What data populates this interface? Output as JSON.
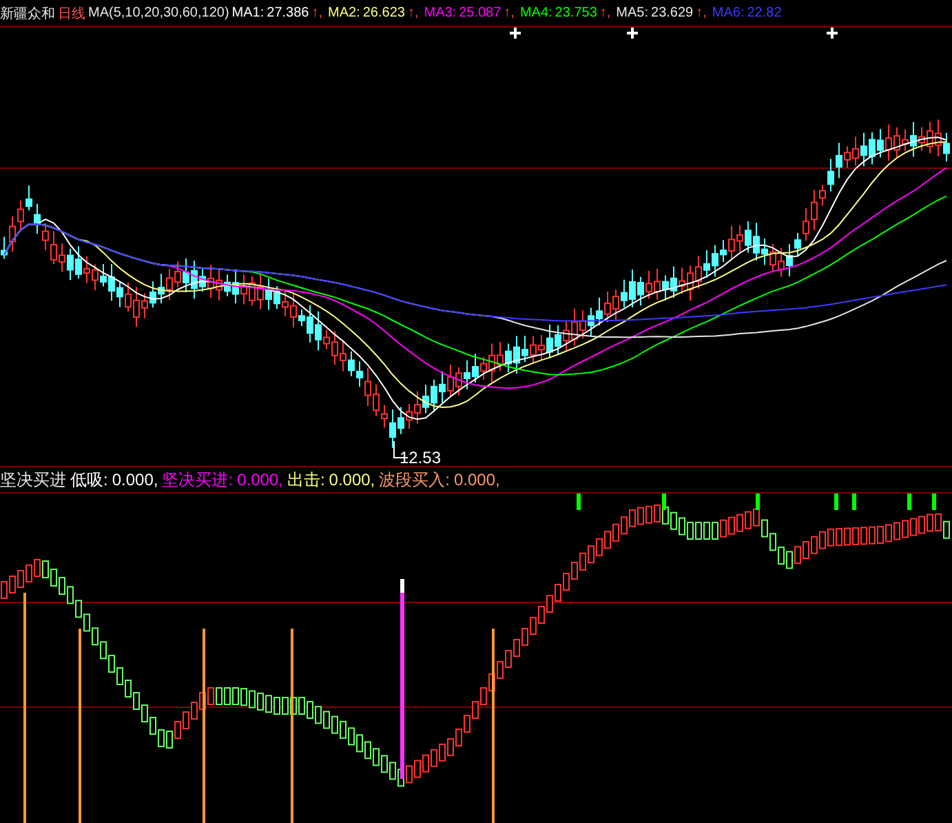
{
  "main_panel": {
    "stock_name": "新疆众和",
    "period": "日线",
    "ma_params": "MA(5,10,20,30,60,120)",
    "ma_items": [
      {
        "label": "MA1:",
        "value": "27.386",
        "arrow": "↑,",
        "color": "#ffffff"
      },
      {
        "label": "MA2:",
        "value": "26.623",
        "arrow": "↑,",
        "color": "#ffff80"
      },
      {
        "label": "MA3:",
        "value": "25.087",
        "arrow": "↑,",
        "color": "#ff00ff"
      },
      {
        "label": "MA4:",
        "value": "23.753",
        "arrow": "↑,",
        "color": "#00ff00"
      },
      {
        "label": "MA5:",
        "value": "23.629",
        "arrow": "↑,",
        "color": "#e6e6e6"
      },
      {
        "label": "MA6:",
        "value": "22.82",
        "color": "#3c3cff"
      }
    ],
    "low_label": "12.53"
  },
  "indicator_panel": {
    "title": "坚决买进",
    "items": [
      {
        "label": "低吸:",
        "value": "0.000,",
        "color": "#ffffff"
      },
      {
        "label": "坚决买进:",
        "value": "0.000,",
        "color": "#ff00ff"
      },
      {
        "label": "出击:",
        "value": "0.000,",
        "color": "#ffff80"
      },
      {
        "label": "波段买入:",
        "value": "0.000,",
        "color": "#ff9966"
      }
    ]
  }
}
